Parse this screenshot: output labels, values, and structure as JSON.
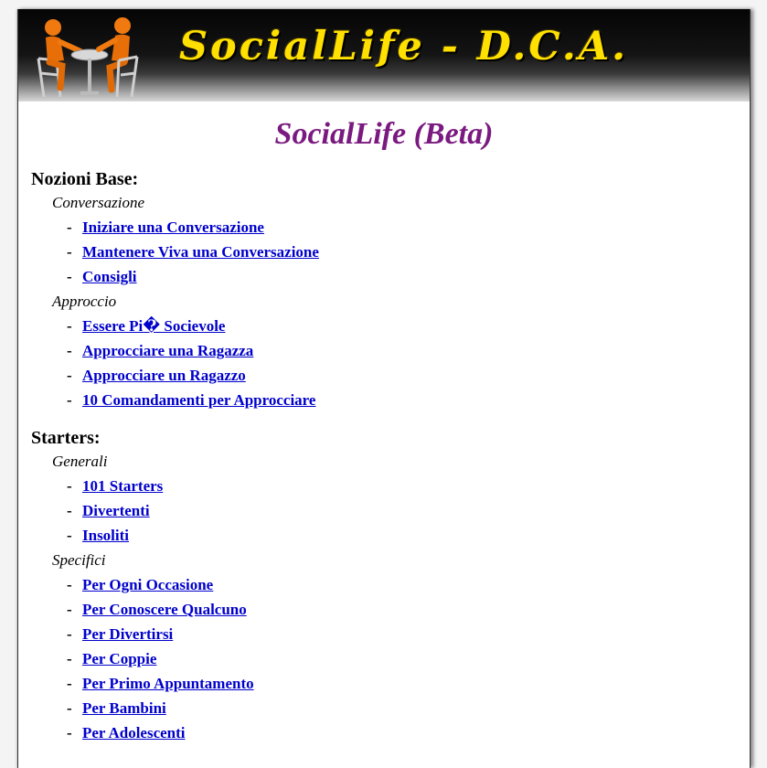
{
  "banner": {
    "title": "SocialLife - D.C.A."
  },
  "site_title": "SocialLife (Beta)",
  "sections": [
    {
      "title": "Nozioni Base:",
      "groups": [
        {
          "label": "Conversazione",
          "links": [
            "Iniziare una Conversazione",
            "Mantenere Viva una Conversazione",
            "Consigli"
          ]
        },
        {
          "label": "Approccio",
          "links": [
            "Essere Pi� Socievole",
            "Approcciare una Ragazza",
            "Approcciare un Ragazzo",
            "10 Comandamenti per Approcciare"
          ]
        }
      ]
    },
    {
      "title": "Starters:",
      "groups": [
        {
          "label": "Generali",
          "links": [
            "101 Starters",
            "Divertenti",
            "Insoliti"
          ]
        },
        {
          "label": "Specifici",
          "links": [
            "Per Ogni Occasione",
            "Per Conoscere Qualcuno",
            "Per Divertirsi",
            "Per Coppie",
            "Per Primo Appuntamento",
            "Per Bambini",
            "Per Adolescenti"
          ]
        }
      ]
    }
  ],
  "colors": {
    "link": "#0000cc",
    "site_title": "#7a1a80",
    "banner_text": "#ffe000",
    "figure": "#f07a10"
  },
  "icons": {
    "banner_logo": "two-people-at-table-icon"
  }
}
